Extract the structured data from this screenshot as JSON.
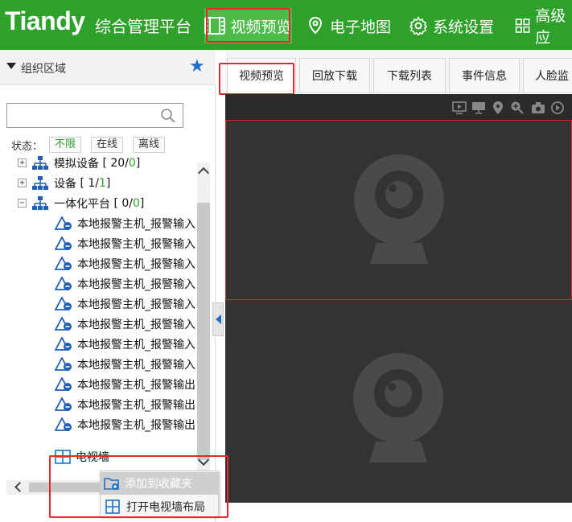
{
  "app": {
    "logo": "Tiandy",
    "title": "综合管理平台"
  },
  "nav": [
    {
      "label": "视频预览",
      "icon": "film-icon"
    },
    {
      "label": "电子地图",
      "icon": "map-pin-icon"
    },
    {
      "label": "系统设置",
      "icon": "gear-icon"
    },
    {
      "label": "高级应",
      "icon": "grid-icon"
    }
  ],
  "sidebar": {
    "header": "组织区域",
    "search_placeholder": "",
    "status_label": "状态：",
    "filters": [
      "不限",
      "在线",
      "离线"
    ],
    "tree": [
      {
        "label": "模拟设备",
        "count_pre": "[ 20/",
        "count_online": "0",
        "count_post": " ]"
      },
      {
        "label": "设备",
        "count_pre": "[ 1/",
        "count_online": "1",
        "count_post": " ]"
      },
      {
        "label": "一体化平台",
        "count_pre": "[ 0/",
        "count_online": "0",
        "count_post": " ]"
      }
    ],
    "alarms": [
      "本地报警主机_报警输入",
      "本地报警主机_报警输入",
      "本地报警主机_报警输入",
      "本地报警主机_报警输入",
      "本地报警主机_报警输入",
      "本地报警主机_报警输入",
      "本地报警主机_报警输入",
      "本地报警主机_报警输入",
      "本地报警主机_报警输出",
      "本地报警主机_报警输出",
      "本地报警主机_报警输出"
    ],
    "tvwall": "电视墙"
  },
  "tabs": [
    "视频预览",
    "回放下载",
    "下载列表",
    "事件信息",
    "人脸监"
  ],
  "context_menu": [
    "添加到收藏夹",
    "打开电视墙布局"
  ],
  "colors": {
    "brand": "#2ea12b",
    "highlight": "#e8272a"
  }
}
